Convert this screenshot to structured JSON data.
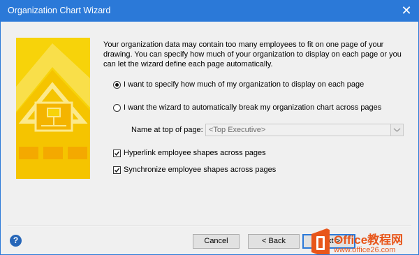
{
  "window": {
    "title": "Organization Chart Wizard"
  },
  "description": "Your organization data may contain too many employees to fit on one page of your drawing.  You can specify how much of your organization to display on each page or you can let the wizard define each page automatically.",
  "options": {
    "manual": {
      "label": "I want to specify how much of my organization to display on each page",
      "selected": true
    },
    "automatic": {
      "label": "I want the wizard to automatically break my organization chart across pages",
      "selected": false
    }
  },
  "name_at_top": {
    "label": "Name at top of page:",
    "value": "<Top Executive>"
  },
  "checkboxes": {
    "hyperlink": {
      "label": "Hyperlink employee shapes across pages",
      "checked": true
    },
    "synchronize": {
      "label": "Synchronize employee shapes across pages",
      "checked": true
    }
  },
  "buttons": {
    "cancel": "Cancel",
    "back": "< Back",
    "next": "Next >"
  },
  "watermark": {
    "brand": "Office教程网",
    "url": "www.office26.com"
  },
  "colors": {
    "accent": "#2b79d8",
    "art_yellow": "#f7d30a",
    "watermark_orange": "#e8561a"
  },
  "icons": {
    "close": "close-icon",
    "help": "help-icon",
    "dropdown": "chevron-down-icon",
    "check": "check-icon"
  }
}
